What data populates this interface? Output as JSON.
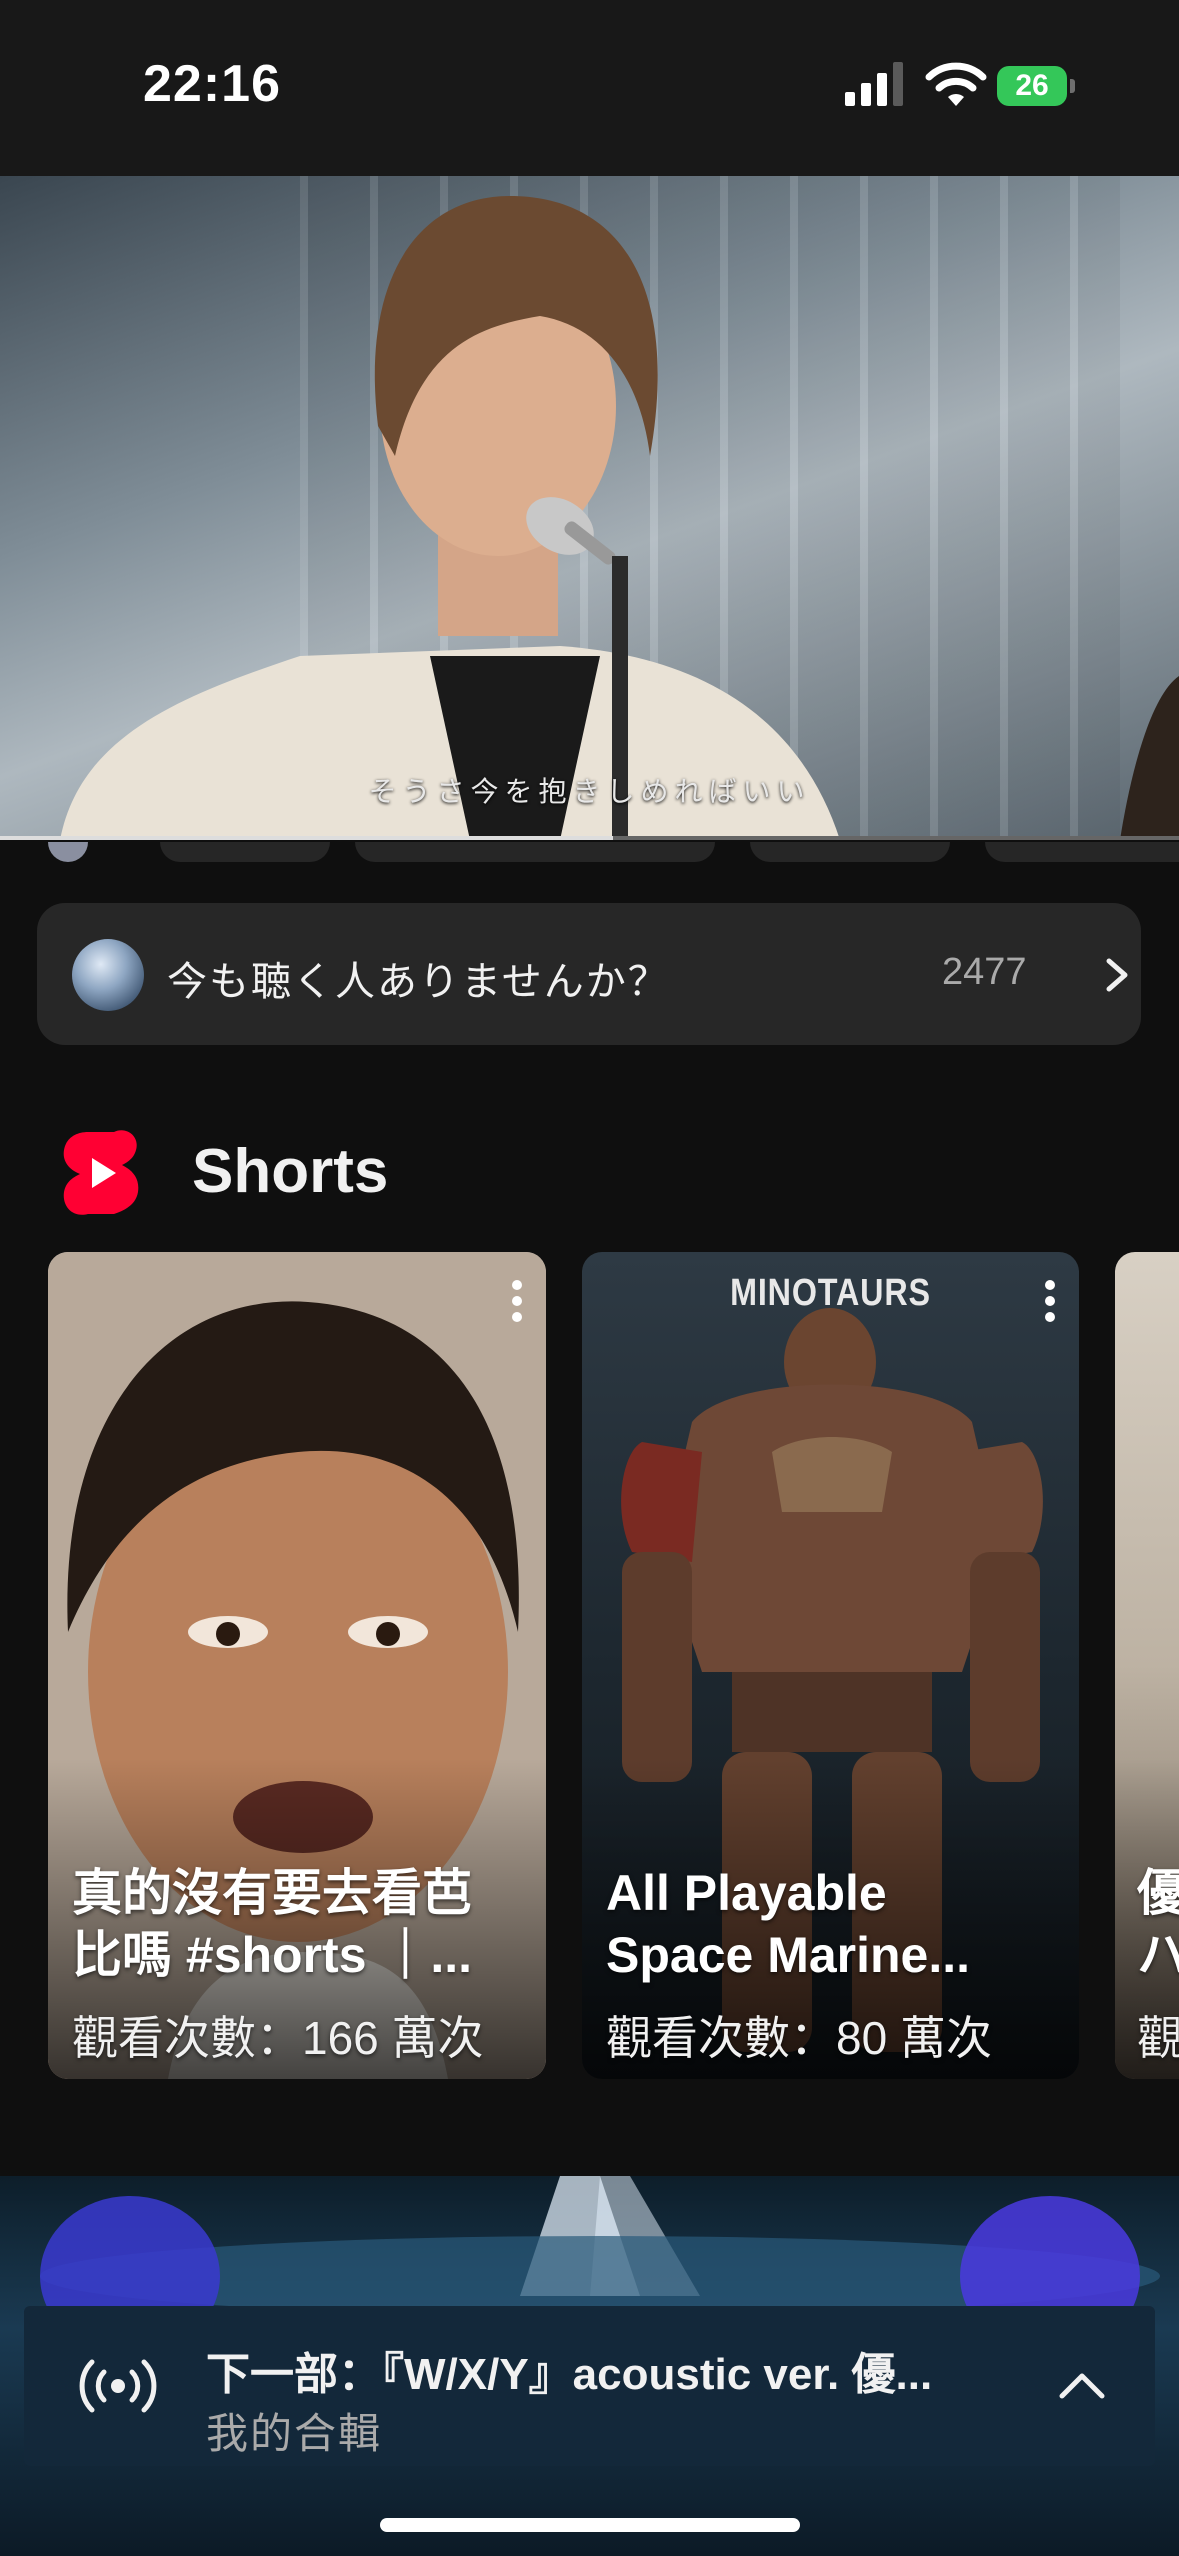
{
  "status_bar": {
    "time": "22:16",
    "battery": "26"
  },
  "player": {
    "subtitle": "そうさ今を抱きしめればいい",
    "progress": 0.52
  },
  "playlist": {
    "title": "今も聴く人ありませんか？",
    "count": "2477"
  },
  "shorts": {
    "title": "Shorts",
    "items": [
      {
        "title_line1": "真的沒有要去看芭",
        "title_line2": "比嗎 #shorts ｜...",
        "views": "觀看次數：166 萬次"
      },
      {
        "overlay_text": "MINOTAURS",
        "title_line1": "All Playable",
        "title_line2": "Space Marine...",
        "views": "觀看次數：80 萬次"
      },
      {
        "title_line1": "優",
        "title_line2": "ハ",
        "views": "觀"
      }
    ]
  },
  "up_next": {
    "label": "下一部：『W/X/Y』acoustic ver. 優...",
    "playlist": "我的合輯"
  },
  "colors": {
    "shorts_red": "#ff0033",
    "battery_green": "#34c759",
    "background": "#0f0f0f"
  }
}
